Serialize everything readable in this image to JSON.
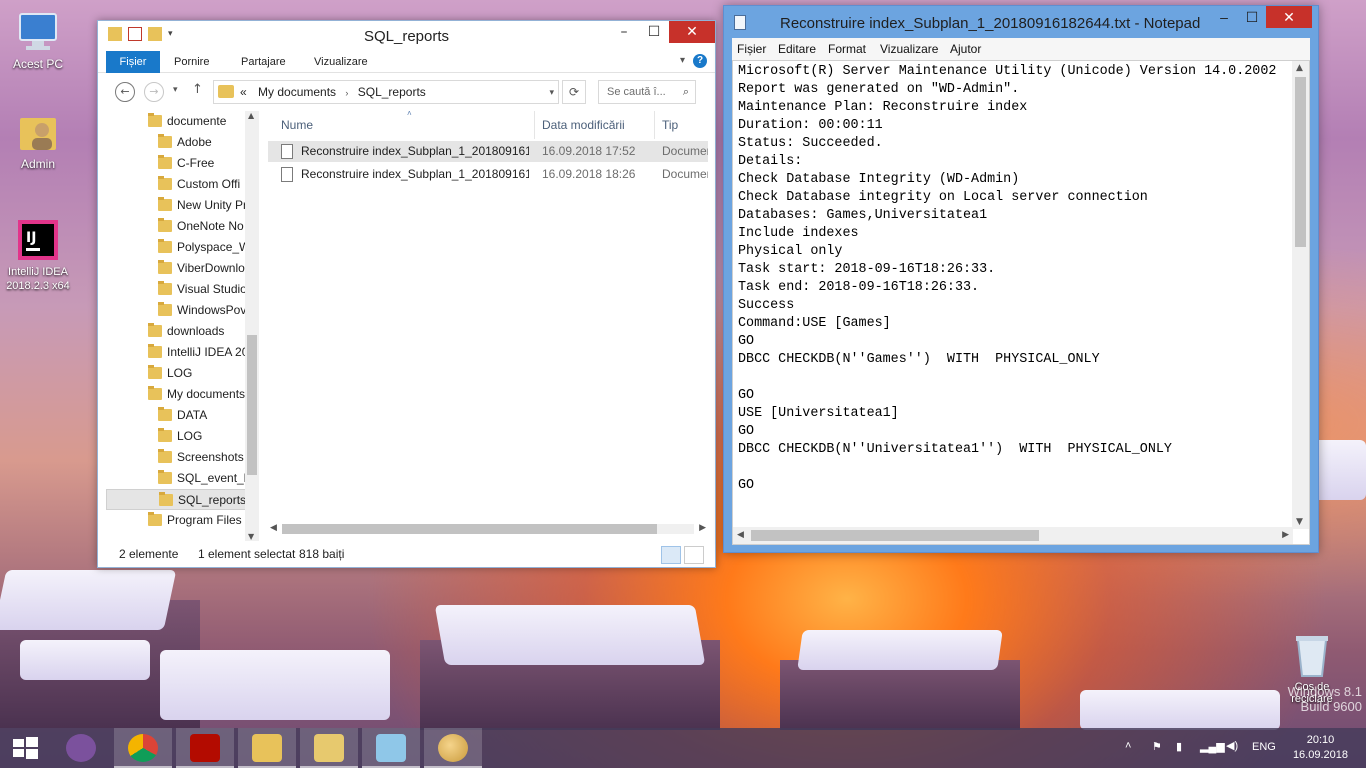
{
  "desktop": {
    "icons": [
      {
        "label": "Acest PC"
      },
      {
        "label": "Admin"
      },
      {
        "label": "IntelliJ IDEA 2018.2.3 x64"
      }
    ],
    "recycle_bin": "Coș de reciclare",
    "watermark": [
      "Windows 8.1",
      "Build 9600"
    ]
  },
  "explorer": {
    "title": "SQL_reports",
    "ribbon_tabs": [
      "Fișier",
      "Pornire",
      "Partajare",
      "Vizualizare"
    ],
    "address": {
      "prefix": "«",
      "crumbs": [
        "My documents",
        "SQL_reports"
      ]
    },
    "search_placeholder": "Se caută î...",
    "tree": [
      {
        "label": "documente",
        "level": 0
      },
      {
        "label": "Adobe",
        "level": 1
      },
      {
        "label": "C-Free",
        "level": 1
      },
      {
        "label": "Custom Offi",
        "level": 1
      },
      {
        "label": "New Unity Pr",
        "level": 1
      },
      {
        "label": "OneNote No",
        "level": 1
      },
      {
        "label": "Polyspace_W",
        "level": 1
      },
      {
        "label": "ViberDownlo",
        "level": 1
      },
      {
        "label": "Visual Studio",
        "level": 1
      },
      {
        "label": "WindowsPov",
        "level": 1
      },
      {
        "label": "downloads",
        "level": 0
      },
      {
        "label": "IntelliJ IDEA 20",
        "level": 0
      },
      {
        "label": "LOG",
        "level": 0
      },
      {
        "label": "My documents",
        "level": 0
      },
      {
        "label": "DATA",
        "level": 1
      },
      {
        "label": "LOG",
        "level": 1
      },
      {
        "label": "Screenshots",
        "level": 1
      },
      {
        "label": "SQL_event_lo",
        "level": 1
      },
      {
        "label": "SQL_reports",
        "level": 1,
        "selected": true
      },
      {
        "label": "Program Files",
        "level": 0
      }
    ],
    "columns": {
      "name": "Nume",
      "date": "Data modificării",
      "type": "Tip"
    },
    "files": [
      {
        "name": "Reconstruire index_Subplan_1_201809161...",
        "date": "16.09.2018 17:52",
        "type": "Documen",
        "selected": true
      },
      {
        "name": "Reconstruire index_Subplan_1_201809161...",
        "date": "16.09.2018 18:26",
        "type": "Documen",
        "selected": false
      }
    ],
    "status": {
      "count": "2 elemente",
      "selection": "1 element selectat",
      "size": "818 baiți"
    }
  },
  "notepad": {
    "title": "Reconstruire index_Subplan_1_20180916182644.txt - Notepad",
    "menu": [
      "Fișier",
      "Editare",
      "Format",
      "Vizualizare",
      "Ajutor"
    ],
    "content": "Microsoft(R) Server Maintenance Utility (Unicode) Version 14.0.2002\nReport was generated on \"WD-Admin\".\nMaintenance Plan: Reconstruire index\nDuration: 00:00:11\nStatus: Succeeded.\nDetails:\nCheck Database Integrity (WD-Admin)\nCheck Database integrity on Local server connection\nDatabases: Games,Universitatea1\nInclude indexes\nPhysical only\nTask start: 2018-09-16T18:26:33.\nTask end: 2018-09-16T18:26:33.\nSuccess\nCommand:USE [Games]\nGO\nDBCC CHECKDB(N''Games'')  WITH  PHYSICAL_ONLY\n\nGO\nUSE [Universitatea1]\nGO\nDBCC CHECKDB(N''Universitatea1'')  WITH  PHYSICAL_ONLY\n\nGO"
  },
  "taskbar": {
    "apps": [
      "start-icon",
      "viber-icon",
      "chrome-dev-icon",
      "acrobat-icon",
      "file-explorer-icon",
      "sql-maintenance-icon",
      "notepad-icon",
      "paint-icon"
    ],
    "language": "ENG",
    "time": "20:10",
    "date": "16.09.2018"
  },
  "colors": {
    "accent": "#1979ca",
    "close": "#c7312a",
    "notepad_frame": "#6ca4e0"
  }
}
